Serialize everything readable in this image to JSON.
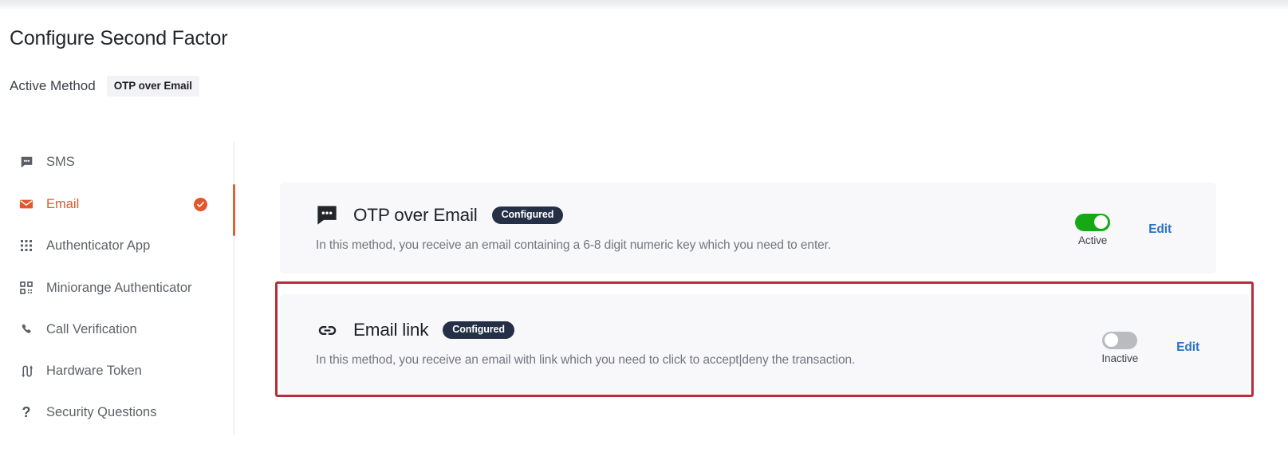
{
  "header": {
    "title": "Configure Second Factor"
  },
  "active_method": {
    "label": "Active Method",
    "value": "OTP over Email"
  },
  "sidebar": {
    "items": [
      {
        "label": "SMS",
        "icon": "sms-chat-icon",
        "active": false,
        "checked": false
      },
      {
        "label": "Email",
        "icon": "envelope-icon",
        "active": true,
        "checked": true
      },
      {
        "label": "Authenticator App",
        "icon": "grid-dots-icon",
        "active": false,
        "checked": false
      },
      {
        "label": "Miniorange Authenticator",
        "icon": "qr-code-icon",
        "active": false,
        "checked": false
      },
      {
        "label": "Call Verification",
        "icon": "phone-icon",
        "active": false,
        "checked": false
      },
      {
        "label": "Hardware Token",
        "icon": "hardware-token-icon",
        "active": false,
        "checked": false
      },
      {
        "label": "Security Questions",
        "icon": "question-mark-icon",
        "active": false,
        "checked": false
      }
    ]
  },
  "methods": [
    {
      "title": "OTP over Email",
      "badge": "Configured",
      "description": "In this method, you receive an email containing a 6-8 digit numeric key which you need to enter.",
      "toggle_state": "on",
      "toggle_label": "Active",
      "edit_label": "Edit",
      "icon": "sms-chat-icon"
    },
    {
      "title": "Email link",
      "badge": "Configured",
      "description": "In this method, you receive an email with link which you need to click to accept|deny the transaction.",
      "toggle_state": "off",
      "toggle_label": "Inactive",
      "edit_label": "Edit",
      "icon": "link-chain-icon"
    }
  ],
  "colors": {
    "accent_orange": "#e0582c",
    "badge_navy": "#253047",
    "toggle_on_green": "#16a916",
    "toggle_off_gray": "#b9bbbf",
    "edit_blue": "#2a72c6",
    "highlight_red": "#b92c3c",
    "card_bg": "#f8f8fa"
  }
}
